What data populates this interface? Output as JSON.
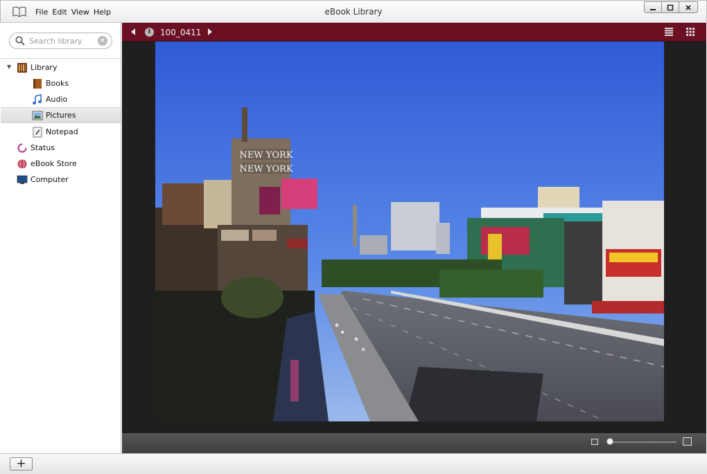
{
  "window": {
    "title": "eBook Library",
    "app_icon": "open-book-icon",
    "controls": {
      "minimize": "–",
      "maximize": "□",
      "close": "✕"
    }
  },
  "menu": [
    "File",
    "Edit",
    "View",
    "Help"
  ],
  "search": {
    "placeholder": "Search library",
    "value": ""
  },
  "sidebar": {
    "items": [
      {
        "label": "Library",
        "icon": "library-icon",
        "level": 0,
        "expanded": true
      },
      {
        "label": "Books",
        "icon": "book-icon",
        "level": 1
      },
      {
        "label": "Audio",
        "icon": "music-note-icon",
        "level": 1
      },
      {
        "label": "Pictures",
        "icon": "picture-icon",
        "level": 1,
        "selected": true
      },
      {
        "label": "Notepad",
        "icon": "notepad-icon",
        "level": 1
      },
      {
        "label": "Status",
        "icon": "status-ring-icon",
        "level": 0
      },
      {
        "label": "eBook Store",
        "icon": "globe-icon",
        "level": 0
      },
      {
        "label": "Computer",
        "icon": "monitor-icon",
        "level": 0
      }
    ]
  },
  "viewer": {
    "image_name": "100_0411",
    "photo_sign_text": [
      "NEW YORK",
      "NEW YORK"
    ],
    "colors": {
      "toolbar": "#6b1022",
      "background": "#1f1f1f"
    }
  },
  "bottom": {
    "add_label": "+"
  }
}
